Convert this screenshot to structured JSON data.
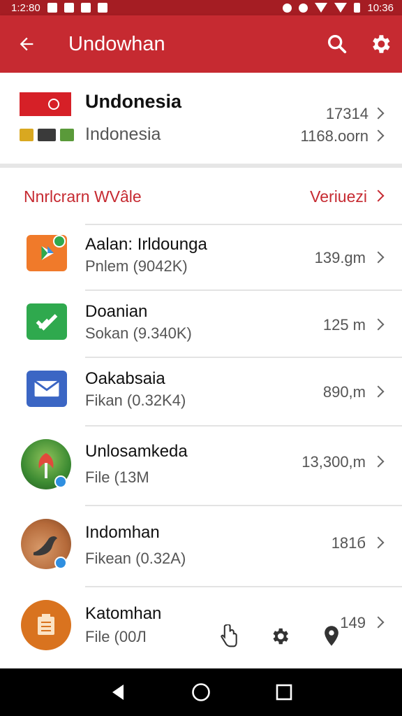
{
  "status_bar": {
    "time": "1:2:80",
    "clock": "10:36"
  },
  "app_bar": {
    "title": "Undowhan"
  },
  "country": {
    "name": "Undonesia",
    "subtitle": "Indonesia",
    "value_top": "17314",
    "value_bottom": "1168.oorn"
  },
  "section": {
    "left": "Nnrlcrarn WVâle",
    "right": "Veriuezi"
  },
  "items": [
    {
      "title": "Aalan: Irldounga",
      "meta": "Pnlem (9042K)",
      "size": "139.gm"
    },
    {
      "title": "Doanian",
      "meta": "Sokan (9.340K)",
      "size": "125 m"
    },
    {
      "title": "Oakabsaia",
      "meta": "Fikan (0.32K4)",
      "size": "890,m"
    },
    {
      "title": "Unlosamkeda",
      "meta": "File (13M",
      "size": "13,300,m"
    },
    {
      "title": "Indomhan",
      "meta": "Fikean (0.32A)",
      "size": "181б"
    },
    {
      "title": "Katomhan",
      "meta": "File (00Л",
      "size": "149"
    }
  ],
  "colors": {
    "primary": "#c62a31",
    "status": "#a51d23"
  }
}
